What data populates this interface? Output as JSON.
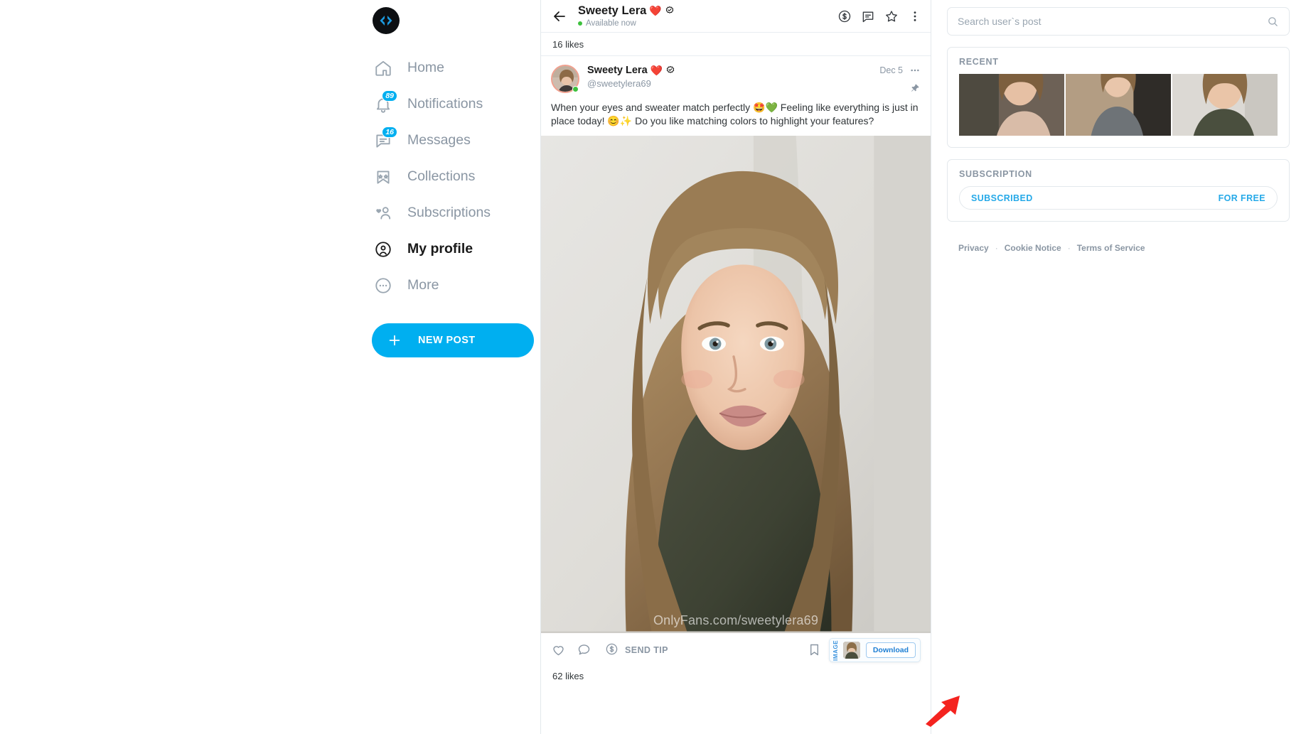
{
  "sidebar": {
    "logo_icon": "code-brackets-logo",
    "items": [
      {
        "label": "Home",
        "icon": "home-icon",
        "badge": "",
        "active": false
      },
      {
        "label": "Notifications",
        "icon": "bell-icon",
        "badge": "89",
        "active": false
      },
      {
        "label": "Messages",
        "icon": "message-icon",
        "badge": "16",
        "active": false
      },
      {
        "label": "Collections",
        "icon": "bookmark-star-icon",
        "badge": "",
        "active": false
      },
      {
        "label": "Subscriptions",
        "icon": "user-heart-icon",
        "badge": "",
        "active": false
      },
      {
        "label": "My profile",
        "icon": "profile-circle-icon",
        "badge": "",
        "active": true
      },
      {
        "label": "More",
        "icon": "ellipsis-circle-icon",
        "badge": "",
        "active": false
      }
    ],
    "new_post_label": "NEW POST"
  },
  "post_header": {
    "back_icon": "back-arrow-icon",
    "name": "Sweety Lera",
    "name_emoji": "❤️",
    "verified_icon": "verified-badge-icon",
    "status": "Available now",
    "actions": [
      {
        "icon": "dollar-circle-icon",
        "name": "send-tip-header-button"
      },
      {
        "icon": "message-icon",
        "name": "message-header-button"
      },
      {
        "icon": "star-icon",
        "name": "favorite-header-button"
      },
      {
        "icon": "vertical-dots-icon",
        "name": "more-header-button"
      }
    ]
  },
  "top_likes": "16 likes",
  "post": {
    "author_name": "Sweety Lera",
    "author_emoji": "❤️",
    "author_handle": "@sweetylera69",
    "date": "Dec 5",
    "more_icon": "horizontal-dots-icon",
    "pin_icon": "pin-icon",
    "text": "When your eyes and sweater match perfectly 🤩💚 Feeling like everything is just in place today! 😊✨ Do you like matching colors to highlight your features?",
    "image_watermark": "OnlyFans.com/sweetylera69",
    "actions": {
      "like_icon": "heart-icon",
      "comment_icon": "comment-icon",
      "tip_icon": "dollar-circle-icon",
      "tip_label": "SEND TIP",
      "bookmark_icon": "bookmark-icon"
    },
    "download_popover": {
      "tag": "IMAGE",
      "thumb_icon": "post-thumbnail",
      "button_label": "Download"
    },
    "bottom_likes": "62 likes"
  },
  "right": {
    "search": {
      "placeholder": "Search user`s post",
      "value": "",
      "icon": "search-icon"
    },
    "recent": {
      "title": "RECENT",
      "thumbs": [
        "recent-thumb-1",
        "recent-thumb-2",
        "recent-thumb-3"
      ]
    },
    "subscription": {
      "title": "SUBSCRIPTION",
      "status_label": "SUBSCRIBED",
      "price_label": "FOR FREE"
    },
    "footer": {
      "links": [
        "Privacy",
        "Cookie Notice",
        "Terms of Service"
      ],
      "separator": "·"
    }
  },
  "annotation": {
    "arrow_icon": "red-arrow-pointer"
  },
  "colors": {
    "accent": "#00aff0",
    "accent_text": "#25a9e8",
    "muted": "#8a96a3",
    "text": "#2f3437",
    "online": "#3ec13e",
    "arrow": "#f4231f"
  }
}
